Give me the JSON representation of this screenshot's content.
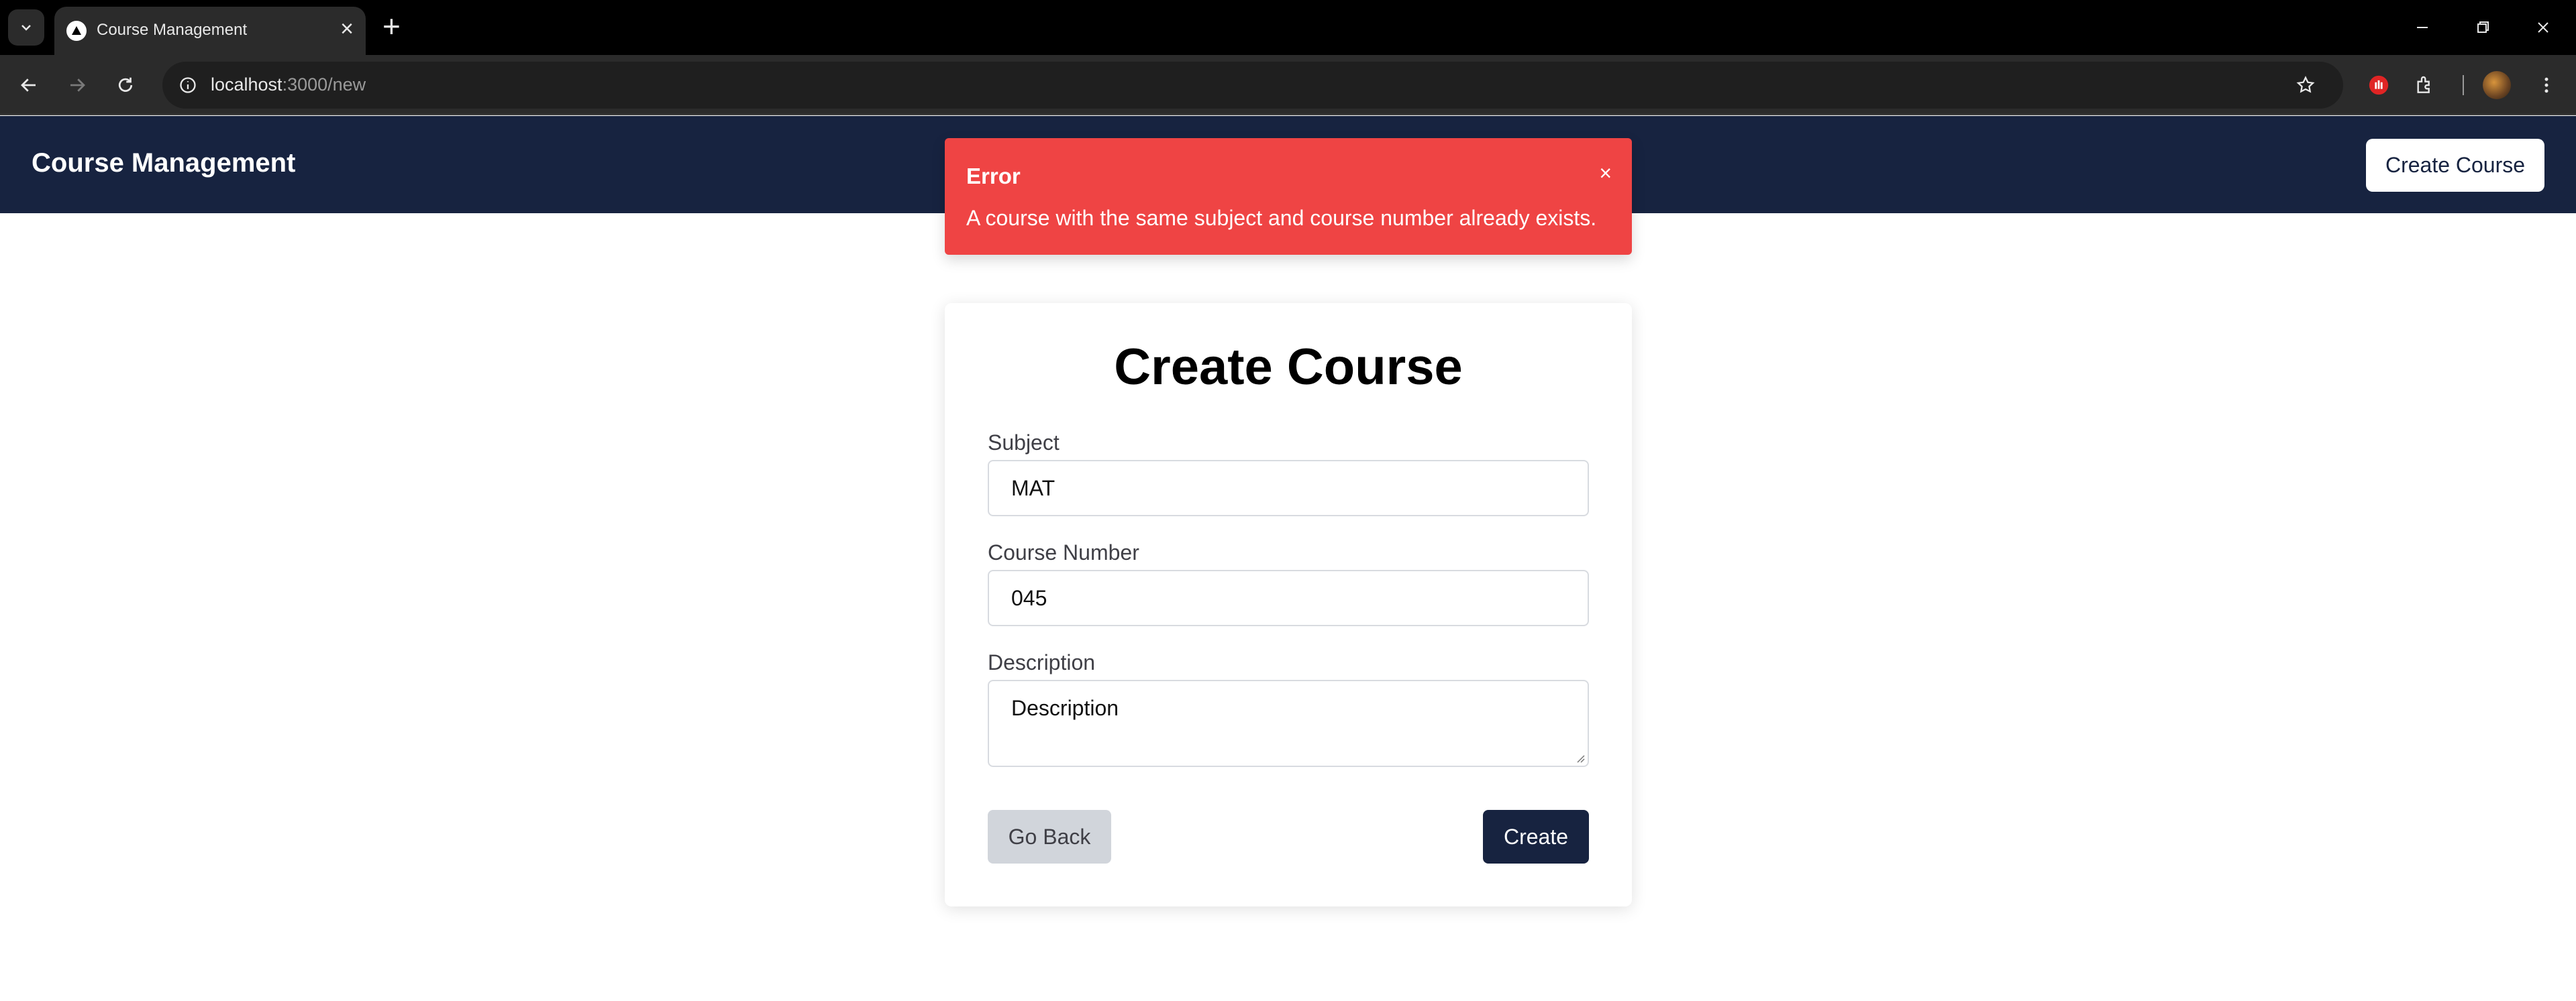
{
  "browser": {
    "tab_title": "Course Management",
    "url_host": "localhost",
    "url_path": ":3000/new",
    "icons": [
      "tab-search-icon",
      "close-icon",
      "plus-icon",
      "minimize-icon",
      "restore-icon",
      "back-icon",
      "forward-icon",
      "reload-icon",
      "info-icon",
      "star-icon",
      "extension-icon",
      "puzzle-icon",
      "kebab-menu-icon"
    ]
  },
  "navbar": {
    "brand": "Course Management",
    "create_button": "Create Course",
    "background": "#172340"
  },
  "toast": {
    "title": "Error",
    "message": "A course with the same subject and course number already exists.",
    "close": "×",
    "color": "#ef4444"
  },
  "form": {
    "title": "Create Course",
    "subject_label": "Subject",
    "subject_value": "MAT",
    "course_number_label": "Course Number",
    "course_number_value": "045",
    "description_label": "Description",
    "description_value": "Description",
    "back_button": "Go Back",
    "create_button": "Create"
  }
}
